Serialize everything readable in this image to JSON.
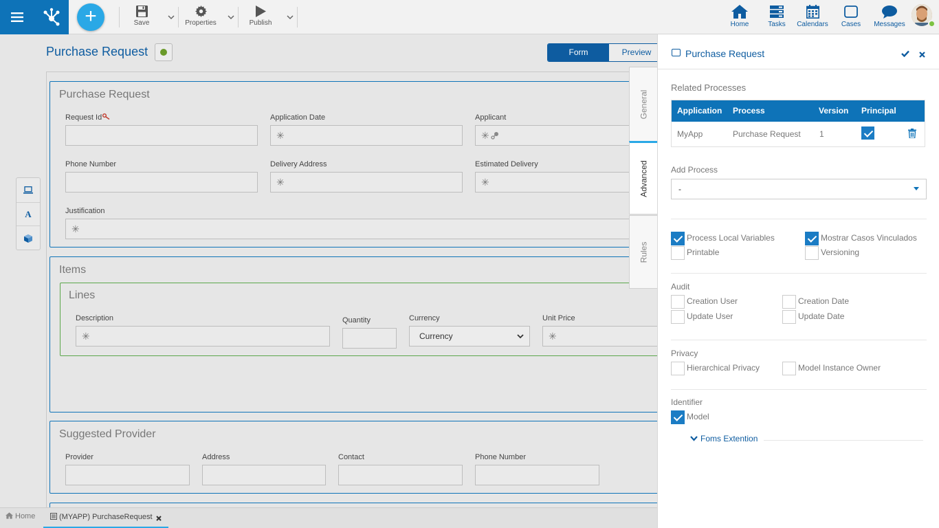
{
  "toolbar": {
    "save_label": "Save",
    "properties_label": "Properties",
    "publish_label": "Publish",
    "add_symbol": "+"
  },
  "nav": {
    "home": "Home",
    "tasks": "Tasks",
    "calendars": "Calendars",
    "cases": "Cases",
    "messages": "Messages"
  },
  "form_header": {
    "title": "Purchase Request",
    "mode_form": "Form",
    "mode_preview": "Preview"
  },
  "side_tools": {
    "text_tool": "A"
  },
  "form": {
    "panel1": {
      "title": "Purchase Request",
      "fields": {
        "request_id": "Request Id",
        "application_date": "Application Date",
        "applicant": "Applicant",
        "phone_number": "Phone Number",
        "delivery_address": "Delivery Address",
        "estimated_delivery": "Estimated Delivery",
        "justification": "Justification"
      }
    },
    "items": {
      "title": "Items",
      "lines_title": "Lines",
      "fields": {
        "description": "Description",
        "quantity": "Quantity",
        "currency": "Currency",
        "currency_value": "Currency",
        "unit_price": "Unit Price"
      }
    },
    "provider": {
      "title": "Suggested Provider",
      "fields": {
        "provider": "Provider",
        "address": "Address",
        "contact": "Contact",
        "phone_number": "Phone Number"
      }
    },
    "asterisk": "✳"
  },
  "vtabs": {
    "general": "General",
    "advanced": "Advanced",
    "rules": "Rules"
  },
  "right_panel": {
    "title": "Purchase Request",
    "related_processes_label": "Related Processes",
    "table": {
      "headers": [
        "Application",
        "Process",
        "Version",
        "Principal"
      ],
      "row": {
        "application": "MyApp",
        "process": "Purchase Request",
        "version": "1",
        "principal": true
      }
    },
    "add_process_label": "Add Process",
    "add_process_value": "-",
    "options": {
      "process_local_variables": {
        "label": "Process Local Variables",
        "checked": true
      },
      "mostrar_casos": {
        "label": "Mostrar Casos Vinculados",
        "checked": true
      },
      "printable": {
        "label": "Printable",
        "checked": false
      },
      "versioning": {
        "label": "Versioning",
        "checked": false
      }
    },
    "audit_label": "Audit",
    "audit": {
      "creation_user": "Creation User",
      "creation_date": "Creation Date",
      "update_user": "Update User",
      "update_date": "Update Date"
    },
    "privacy_label": "Privacy",
    "privacy": {
      "hierarchical": "Hierarchical Privacy",
      "owner": "Model Instance Owner"
    },
    "identifier_label": "Identifier",
    "identifier_model": "Model",
    "foms_extention": "Foms Extention"
  },
  "bottom_tabs": {
    "home": "Home",
    "document": "(MYAPP) PurchaseRequest"
  },
  "colors": {
    "primary": "#0e73b8",
    "accent": "#2aa8e6",
    "status_green": "#6a9a2a",
    "lines_border": "#5aa64a"
  }
}
